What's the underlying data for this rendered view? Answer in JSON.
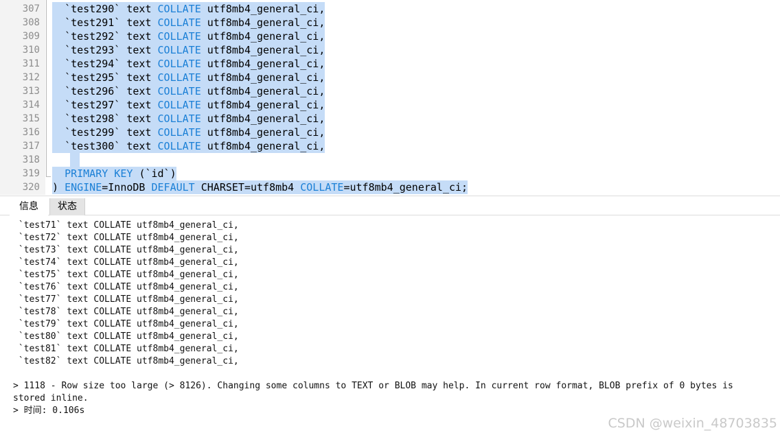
{
  "editor": {
    "lines": [
      {
        "n": "307",
        "name": "`test290`",
        "type": "text",
        "kw": "COLLATE",
        "coll": "utf8mb4_general_ci,"
      },
      {
        "n": "308",
        "name": "`test291`",
        "type": "text",
        "kw": "COLLATE",
        "coll": "utf8mb4_general_ci,"
      },
      {
        "n": "309",
        "name": "`test292`",
        "type": "text",
        "kw": "COLLATE",
        "coll": "utf8mb4_general_ci,"
      },
      {
        "n": "310",
        "name": "`test293`",
        "type": "text",
        "kw": "COLLATE",
        "coll": "utf8mb4_general_ci,"
      },
      {
        "n": "311",
        "name": "`test294`",
        "type": "text",
        "kw": "COLLATE",
        "coll": "utf8mb4_general_ci,"
      },
      {
        "n": "312",
        "name": "`test295`",
        "type": "text",
        "kw": "COLLATE",
        "coll": "utf8mb4_general_ci,"
      },
      {
        "n": "313",
        "name": "`test296`",
        "type": "text",
        "kw": "COLLATE",
        "coll": "utf8mb4_general_ci,"
      },
      {
        "n": "314",
        "name": "`test297`",
        "type": "text",
        "kw": "COLLATE",
        "coll": "utf8mb4_general_ci,"
      },
      {
        "n": "315",
        "name": "`test298`",
        "type": "text",
        "kw": "COLLATE",
        "coll": "utf8mb4_general_ci,"
      },
      {
        "n": "316",
        "name": "`test299`",
        "type": "text",
        "kw": "COLLATE",
        "coll": "utf8mb4_general_ci,"
      },
      {
        "n": "317",
        "name": "`test300`",
        "type": "text",
        "kw": "COLLATE",
        "coll": "utf8mb4_general_ci,"
      }
    ],
    "blank_line_number": "318",
    "pk_line": {
      "n": "319",
      "kw": "PRIMARY KEY",
      "rest": "(`id`)"
    },
    "end_line": {
      "n": "320",
      "paren": ")",
      "engine_kw": "ENGINE",
      "engine_val": "=InnoDB",
      "default_kw": "DEFAULT",
      "charset": "CHARSET=utf8mb4",
      "collate_kw": "COLLATE",
      "collate_val": "=utf8mb4_general_ci;"
    }
  },
  "tabs": {
    "info": "信息",
    "status": "状态"
  },
  "output": {
    "lines": [
      " `test71` text COLLATE utf8mb4_general_ci,",
      " `test72` text COLLATE utf8mb4_general_ci,",
      " `test73` text COLLATE utf8mb4_general_ci,",
      " `test74` text COLLATE utf8mb4_general_ci,",
      " `test75` text COLLATE utf8mb4_general_ci,",
      " `test76` text COLLATE utf8mb4_general_ci,",
      " `test77` text COLLATE utf8mb4_general_ci,",
      " `test78` text COLLATE utf8mb4_general_ci,",
      " `test79` text COLLATE utf8mb4_general_ci,",
      " `test80` text COLLATE utf8mb4_general_ci,",
      " `test81` text COLLATE utf8mb4_general_ci,",
      " `test82` text COLLATE utf8mb4_general_ci,"
    ],
    "error_line1": "> 1118 - Row size too large (> 8126). Changing some columns to TEXT or BLOB may help. In current row format, BLOB prefix of 0 bytes is",
    "error_line2": "stored inline.",
    "time_line": "> 时间: 0.106s"
  },
  "watermark": "CSDN @weixin_48703835",
  "colors": {
    "keyword": "#1a7fd6",
    "selection": "#c5dcf7",
    "gutter": "#f3f3f3",
    "line_number": "#8c8c8c"
  }
}
